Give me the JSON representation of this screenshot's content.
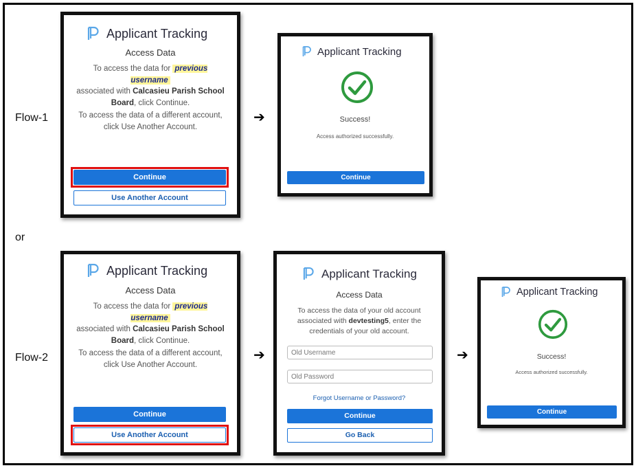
{
  "app_title": "Applicant Tracking",
  "labels": {
    "flow1": "Flow-1",
    "or": "or",
    "flow2": "Flow-2",
    "arrow": "➔"
  },
  "access_card": {
    "heading": "Access Data",
    "line1": "To access the data for",
    "username_highlight": "previous username",
    "line2": "associated with",
    "org": "Calcasieu Parish School Board",
    "line3": ", click Continue.",
    "other_account_text": "To access the data of a different account, click Use Another Account.",
    "continue_label": "Continue",
    "use_another_label": "Use Another Account"
  },
  "success_card": {
    "title": "Success!",
    "message": "Access authorized successfully.",
    "continue_label": "Continue"
  },
  "old_account_card": {
    "heading": "Access Data",
    "line1": "To access the data of your old account associated with",
    "account": "devtesting5",
    "line2": ", enter the credentials of your old account.",
    "username_placeholder": "Old Username",
    "password_placeholder": "Old Password",
    "forgot_label": "Forgot Username or Password?",
    "continue_label": "Continue",
    "go_back_label": "Go Back"
  },
  "colors": {
    "primary": "#1b74d9",
    "success_green": "#2e9a3e",
    "highlight": "#fff59a",
    "redbox": "#e01010",
    "logo": "#5aa7e8"
  }
}
